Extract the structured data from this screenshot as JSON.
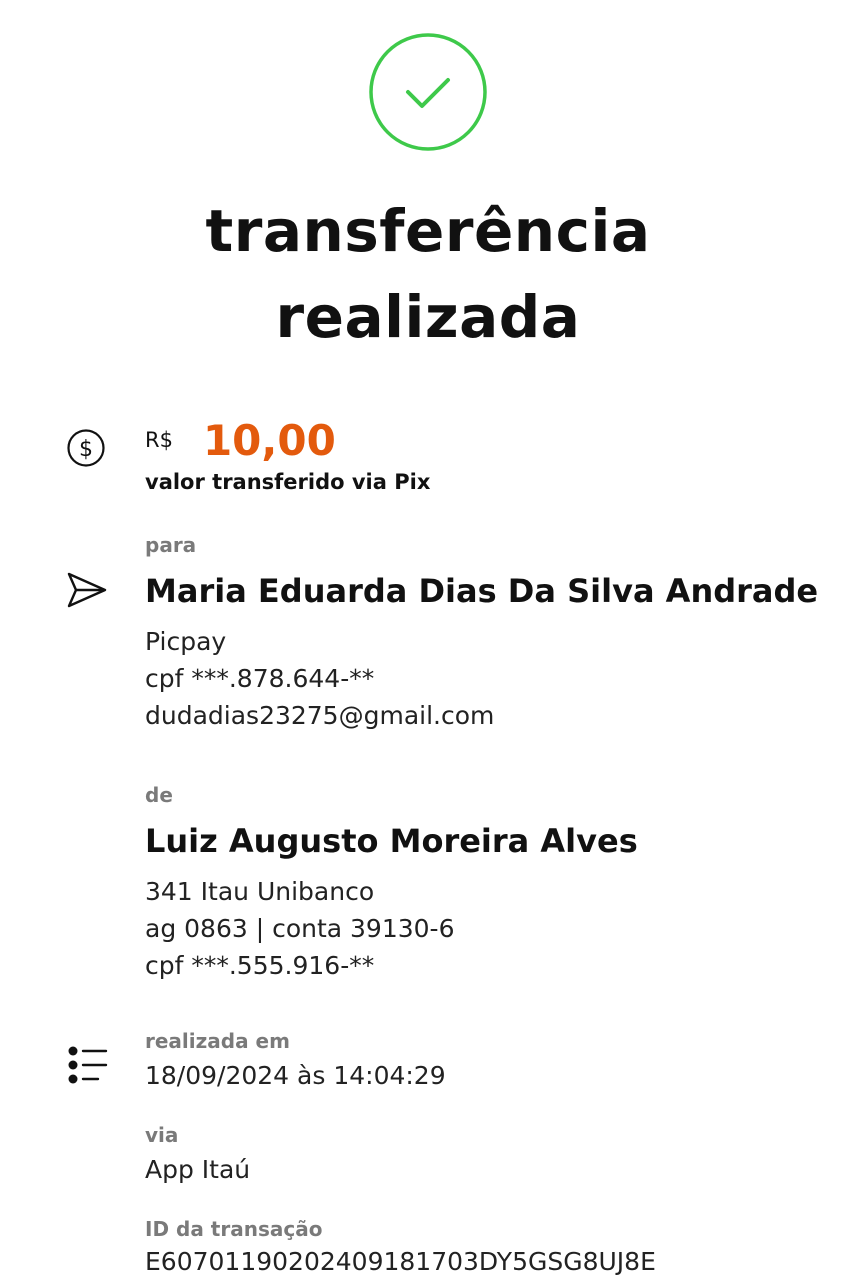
{
  "status": {
    "title_line1": "transferência",
    "title_line2": "realizada"
  },
  "amount": {
    "currency": "R$",
    "value": "10,00",
    "description": "valor transferido via Pix"
  },
  "recipient": {
    "label": "para",
    "name": "Maria Eduarda Dias Da Silva Andrade",
    "bank": " Picpay",
    "cpf": "cpf ***.878.644-**",
    "email": "dudadias23275@gmail.com"
  },
  "sender": {
    "label": "de",
    "name": "Luiz Augusto Moreira Alves",
    "bank": "341 Itau Unibanco",
    "account": "ag 0863 | conta 39130-6",
    "cpf": "cpf ***.555.916-**"
  },
  "details": {
    "date_label": "realizada em",
    "date_value": "18/09/2024 às 14:04:29",
    "via_label": "via",
    "via_value": "App Itaú",
    "id_label": "ID da transação",
    "id_value": "E60701190202409181703DY5GSG8UJ8E"
  },
  "icons": {
    "success": "check-circle-icon",
    "money": "dollar-circle-icon",
    "send": "paper-plane-icon",
    "list": "list-icon"
  },
  "colors": {
    "success": "#3ec94a",
    "amount": "#e35a0d",
    "label": "#7a7a7a"
  }
}
